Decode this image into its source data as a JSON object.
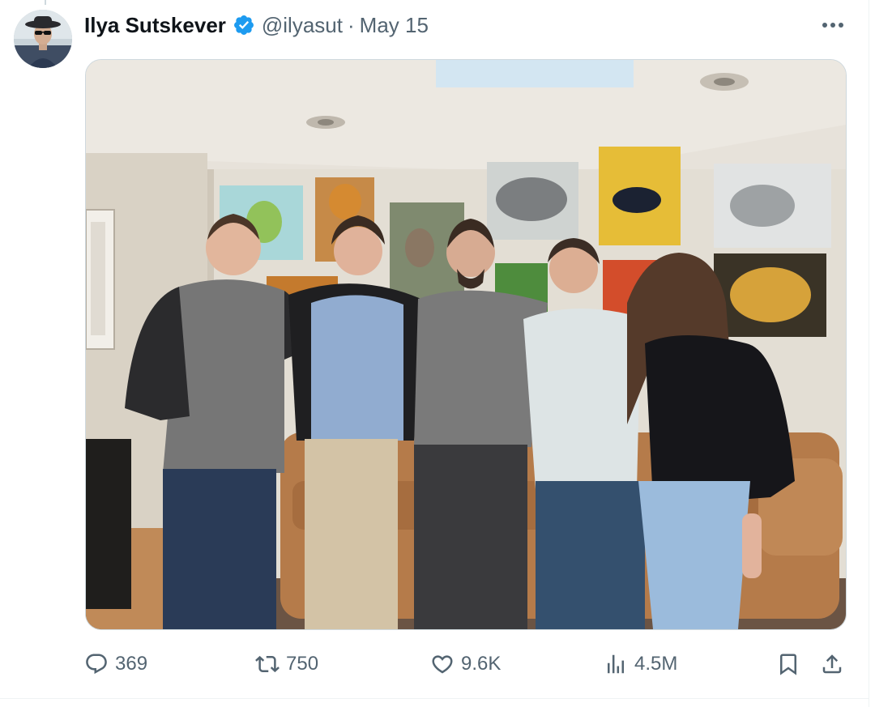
{
  "tweet": {
    "author": {
      "name": "Ilya Sutskever",
      "handle": "@ilyasut",
      "verified": true,
      "avatar_icon": "profile-photo-hat-sunglasses"
    },
    "separator": "·",
    "date": "May 15",
    "more_icon": "ellipsis-icon",
    "media": {
      "type": "photo",
      "alt": "Group photo of five people standing in front of a leather couch with paintings on the wall"
    },
    "actions": {
      "replies": "369",
      "retweets": "750",
      "likes": "9.6K",
      "views": "4.5M"
    }
  },
  "colors": {
    "verified_badge": "#1d9bf0",
    "secondary_text": "#536471",
    "primary_text": "#0f1419",
    "border": "#cfd9de"
  }
}
